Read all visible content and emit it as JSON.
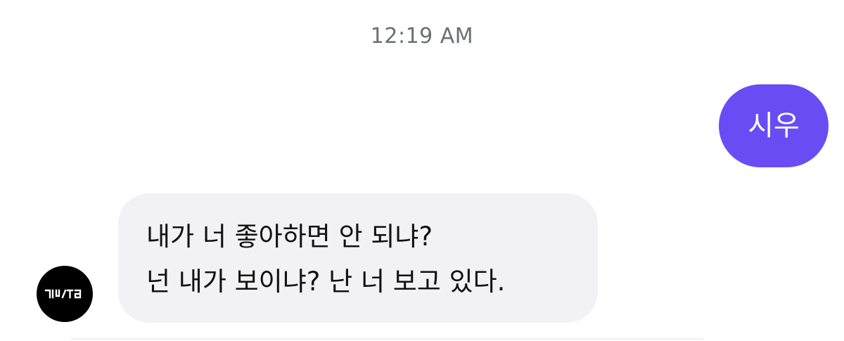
{
  "timestamp": "12:19 AM",
  "messages": [
    {
      "direction": "sent",
      "text": "시우"
    },
    {
      "direction": "received",
      "lines": [
        "내가 너 좋아하면 안 되냐?",
        "넌 내가 보이냐? 난 너 보고 있다."
      ]
    }
  ],
  "avatar": {
    "logo_text": "ZIJSTB"
  },
  "colors": {
    "sent_bubble": "#6a4cf5",
    "received_bubble": "#f2f2f4",
    "timestamp_text": "#6b6f76",
    "avatar_bg": "#000000"
  }
}
